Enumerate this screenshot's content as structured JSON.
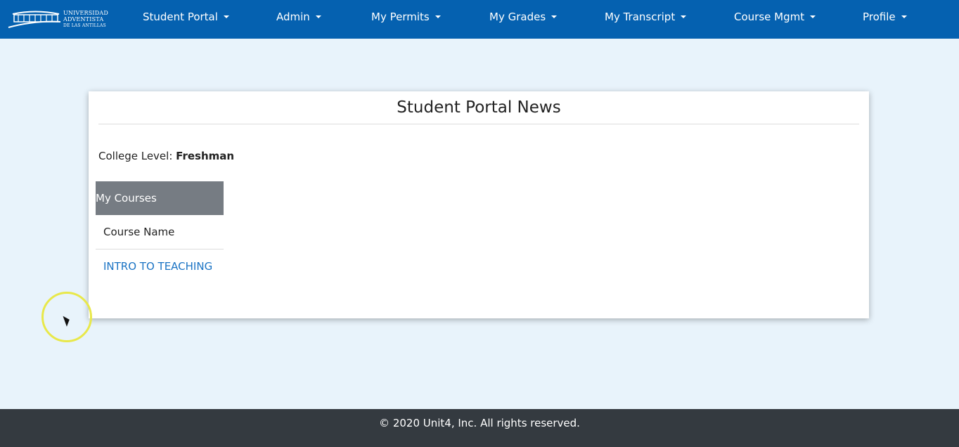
{
  "brand": {
    "line1": "UNIVERSIDAD",
    "line2": "ADVENTISTA",
    "line3": "DE LAS ANTILLAS"
  },
  "nav": [
    {
      "label": "Student Portal"
    },
    {
      "label": "Admin"
    },
    {
      "label": "My Permits"
    },
    {
      "label": "My Grades"
    },
    {
      "label": "My Transcript"
    },
    {
      "label": "Course Mgmt"
    },
    {
      "label": "Profile"
    }
  ],
  "card": {
    "title": "Student Portal News",
    "level_label": "College Level:",
    "level_value": "Freshman",
    "courses_header": "My Courses",
    "column_header": "Course Name",
    "courses": [
      {
        "name": "INTRO TO TEACHING"
      }
    ]
  },
  "footer": {
    "text": "© 2020 Unit4, Inc. All rights reserved."
  },
  "colors": {
    "nav": "#0561b0",
    "background": "#e8f3fb",
    "footer": "#343a40",
    "link": "#1a73c4"
  }
}
